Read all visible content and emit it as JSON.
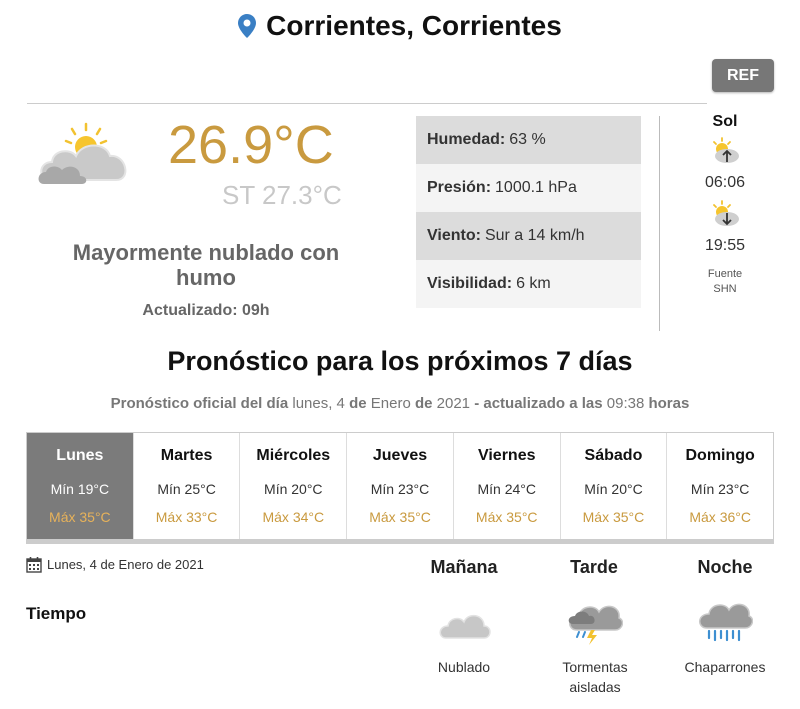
{
  "header": {
    "location": "Corrientes, Corrientes",
    "ref_label": "REF"
  },
  "current": {
    "temperature": "26.9°C",
    "feels_like": "ST 27.3°C",
    "condition": "Mayormente nublado con humo",
    "updated": "Actualizado: 09h",
    "icon": "partly-cloudy-icon"
  },
  "stats": [
    {
      "label": "Humedad:",
      "value": "63 %"
    },
    {
      "label": "Presión:",
      "value": "1000.1 hPa"
    },
    {
      "label": "Viento:",
      "value": "Sur a 14 km/h"
    },
    {
      "label": "Visibilidad:",
      "value": "6 km"
    }
  ],
  "sun": {
    "title": "Sol",
    "sunrise": "06:06",
    "sunset": "19:55",
    "source_line1": "Fuente",
    "source_line2": "SHN"
  },
  "forecast": {
    "title": "Pronóstico para los próximos 7 días",
    "sub_prefix": "Pronóstico oficial del día",
    "sub_day": "lunes, 4",
    "sub_de1": "de",
    "sub_month": "Enero",
    "sub_de2": "de",
    "sub_year": "2021",
    "sub_updated": "- actualizado a las",
    "sub_time": "09:38",
    "sub_hours": "horas",
    "days": [
      {
        "name": "Lunes",
        "min": "Mín 19°C",
        "max": "Máx 35°C",
        "active": true
      },
      {
        "name": "Martes",
        "min": "Mín 25°C",
        "max": "Máx 33°C"
      },
      {
        "name": "Miércoles",
        "min": "Mín 20°C",
        "max": "Máx 34°C"
      },
      {
        "name": "Jueves",
        "min": "Mín 23°C",
        "max": "Máx 35°C"
      },
      {
        "name": "Viernes",
        "min": "Mín 24°C",
        "max": "Máx 35°C"
      },
      {
        "name": "Sábado",
        "min": "Mín 20°C",
        "max": "Máx 35°C"
      },
      {
        "name": "Domingo",
        "min": "Mín 23°C",
        "max": "Máx 36°C"
      }
    ]
  },
  "detail": {
    "date": "Lunes, 4 de Enero de 2021",
    "row_label": "Tiempo",
    "periods": [
      {
        "name": "Mañana",
        "condition": "Nublado",
        "icon": "cloudy-icon"
      },
      {
        "name": "Tarde",
        "condition_line1": "Tormentas",
        "condition_line2": "aisladas",
        "icon": "thunderstorm-icon"
      },
      {
        "name": "Noche",
        "condition": "Chaparrones",
        "icon": "showers-icon"
      }
    ]
  },
  "colors": {
    "accent_temp": "#c99a3f",
    "active_day_bg": "#7b7b7b",
    "ref_button": "#777777",
    "pin": "#3a7fc4"
  }
}
